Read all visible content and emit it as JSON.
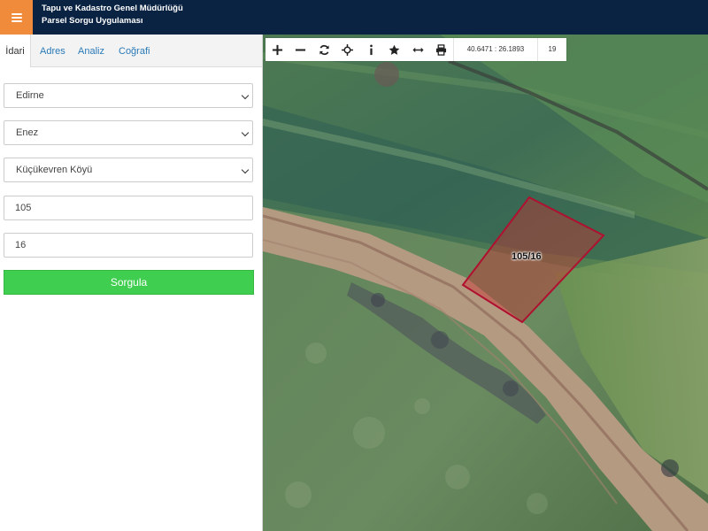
{
  "header": {
    "title_line1": "Tapu ve Kadastro Genel Müdürlüğü",
    "title_line2": "Parsel Sorgu Uygulaması",
    "menu_icon": "hamburger-icon",
    "accent_color": "#f08b3c",
    "bar_color": "#0a2343"
  },
  "tabs": [
    {
      "label": "İdari",
      "active": true
    },
    {
      "label": "Adres"
    },
    {
      "label": "Analiz"
    },
    {
      "label": "Coğrafi"
    }
  ],
  "form": {
    "province": "Edirne",
    "district": "Enez",
    "neighborhood": "Küçükevren Köyü",
    "block": "105",
    "parcel": "16",
    "submit_label": "Sorgula",
    "submit_color": "#3fce4f"
  },
  "map": {
    "toolbar_icons": [
      "zoom-in-icon",
      "zoom-out-icon",
      "refresh-icon",
      "locate-icon",
      "info-icon",
      "favorite-icon",
      "measure-icon",
      "print-icon"
    ],
    "coordinates": "40.6471 : 26.1893",
    "zoom_level": "19",
    "parcel_label": "105/16",
    "parcel_color": "#b01030"
  }
}
